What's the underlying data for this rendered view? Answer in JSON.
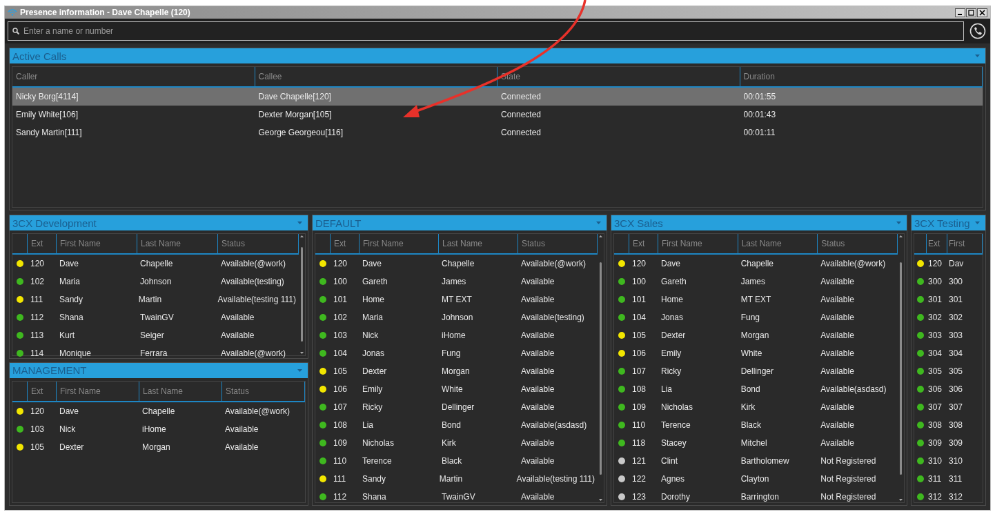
{
  "window": {
    "title": "Presence information - Dave Chapelle (120)"
  },
  "search": {
    "placeholder": "Enter a name or number"
  },
  "active_calls": {
    "title": "Active Calls",
    "columns": [
      "Caller",
      "Callee",
      "State",
      "Duration"
    ],
    "rows": [
      {
        "selected": true,
        "cells": [
          "Nicky Borg[4114]",
          "Dave Chapelle[120]",
          "Connected",
          "00:01:55"
        ]
      },
      {
        "selected": false,
        "cells": [
          "Emily White[106]",
          "Dexter Morgan[105]",
          "Connected",
          "00:01:43"
        ]
      },
      {
        "selected": false,
        "cells": [
          "Sandy Martin[111]",
          "George Georgeou[116]",
          "Connected",
          "00:01:11"
        ]
      }
    ]
  },
  "group_columns": [
    {
      "groups": [
        {
          "title": "3CX Development",
          "scrollbar": true,
          "columns": [
            "Ext",
            "First Name",
            "Last Name",
            "Status"
          ],
          "rows": [
            {
              "color": "#f2e600",
              "cells": [
                "120",
                "Dave",
                "Chapelle",
                "Available(@work)"
              ]
            },
            {
              "color": "#3fb81f",
              "cells": [
                "102",
                "Maria",
                "Johnson",
                "Available(testing)"
              ]
            },
            {
              "color": "#f2e600",
              "cells": [
                "111",
                "Sandy",
                "Martin",
                "Available(testing 111)"
              ]
            },
            {
              "color": "#3fb81f",
              "cells": [
                "112",
                "Shana",
                "TwainGV",
                "Available"
              ]
            },
            {
              "color": "#3fb81f",
              "cells": [
                "113",
                "Kurt",
                "Seiger",
                "Available"
              ]
            },
            {
              "color": "#3fb81f",
              "cells": [
                "114",
                "Monique",
                "Ferrara",
                "Available(@work)"
              ]
            }
          ]
        },
        {
          "title": "MANAGEMENT",
          "scrollbar": false,
          "columns": [
            "Ext",
            "First Name",
            "Last Name",
            "Status"
          ],
          "rows": [
            {
              "color": "#f2e600",
              "cells": [
                "120",
                "Dave",
                "Chapelle",
                "Available(@work)"
              ]
            },
            {
              "color": "#3fb81f",
              "cells": [
                "103",
                "Nick",
                "iHome",
                "Available"
              ]
            },
            {
              "color": "#f2e600",
              "cells": [
                "105",
                "Dexter",
                "Morgan",
                "Available"
              ]
            }
          ]
        }
      ]
    },
    {
      "groups": [
        {
          "title": "DEFAULT",
          "scrollbar": true,
          "columns": [
            "Ext",
            "First Name",
            "Last Name",
            "Status"
          ],
          "rows": [
            {
              "color": "#f2e600",
              "cells": [
                "120",
                "Dave",
                "Chapelle",
                "Available(@work)"
              ]
            },
            {
              "color": "#3fb81f",
              "cells": [
                "100",
                "Gareth",
                "James",
                "Available"
              ]
            },
            {
              "color": "#3fb81f",
              "cells": [
                "101",
                "Home",
                "MT EXT",
                "Available"
              ]
            },
            {
              "color": "#3fb81f",
              "cells": [
                "102",
                "Maria",
                "Johnson",
                "Available(testing)"
              ]
            },
            {
              "color": "#3fb81f",
              "cells": [
                "103",
                "Nick",
                "iHome",
                "Available"
              ]
            },
            {
              "color": "#3fb81f",
              "cells": [
                "104",
                "Jonas",
                "Fung",
                "Available"
              ]
            },
            {
              "color": "#f2e600",
              "cells": [
                "105",
                "Dexter",
                "Morgan",
                "Available"
              ]
            },
            {
              "color": "#f2e600",
              "cells": [
                "106",
                "Emily",
                "White",
                "Available"
              ]
            },
            {
              "color": "#3fb81f",
              "cells": [
                "107",
                "Ricky",
                "Dellinger",
                "Available"
              ]
            },
            {
              "color": "#3fb81f",
              "cells": [
                "108",
                "Lia",
                "Bond",
                "Available(asdasd)"
              ]
            },
            {
              "color": "#3fb81f",
              "cells": [
                "109",
                "Nicholas",
                "Kirk",
                "Available"
              ]
            },
            {
              "color": "#3fb81f",
              "cells": [
                "110",
                "Terence",
                "Black",
                "Available"
              ]
            },
            {
              "color": "#f2e600",
              "cells": [
                "111",
                "Sandy",
                "Martin",
                "Available(testing 111)"
              ]
            },
            {
              "color": "#3fb81f",
              "cells": [
                "112",
                "Shana",
                "TwainGV",
                "Available"
              ]
            }
          ]
        }
      ]
    },
    {
      "groups": [
        {
          "title": "3CX Sales",
          "scrollbar": true,
          "columns": [
            "Ext",
            "First Name",
            "Last Name",
            "Status"
          ],
          "rows": [
            {
              "color": "#f2e600",
              "cells": [
                "120",
                "Dave",
                "Chapelle",
                "Available(@work)"
              ]
            },
            {
              "color": "#3fb81f",
              "cells": [
                "100",
                "Gareth",
                "James",
                "Available"
              ]
            },
            {
              "color": "#3fb81f",
              "cells": [
                "101",
                "Home",
                "MT EXT",
                "Available"
              ]
            },
            {
              "color": "#3fb81f",
              "cells": [
                "104",
                "Jonas",
                "Fung",
                "Available"
              ]
            },
            {
              "color": "#f2e600",
              "cells": [
                "105",
                "Dexter",
                "Morgan",
                "Available"
              ]
            },
            {
              "color": "#f2e600",
              "cells": [
                "106",
                "Emily",
                "White",
                "Available"
              ]
            },
            {
              "color": "#3fb81f",
              "cells": [
                "107",
                "Ricky",
                "Dellinger",
                "Available"
              ]
            },
            {
              "color": "#3fb81f",
              "cells": [
                "108",
                "Lia",
                "Bond",
                "Available(asdasd)"
              ]
            },
            {
              "color": "#3fb81f",
              "cells": [
                "109",
                "Nicholas",
                "Kirk",
                "Available"
              ]
            },
            {
              "color": "#3fb81f",
              "cells": [
                "110",
                "Terence",
                "Black",
                "Available"
              ]
            },
            {
              "color": "#3fb81f",
              "cells": [
                "118",
                "Stacey",
                "Mitchel",
                "Available"
              ]
            },
            {
              "color": "#c8c8c8",
              "cells": [
                "121",
                "Clint",
                "Bartholomew",
                "Not Registered"
              ]
            },
            {
              "color": "#c8c8c8",
              "cells": [
                "122",
                "Agnes",
                "Clayton",
                "Not Registered"
              ]
            },
            {
              "color": "#c8c8c8",
              "cells": [
                "123",
                "Dorothy",
                "Barrington",
                "Not Registered"
              ]
            }
          ]
        }
      ]
    },
    {
      "groups": [
        {
          "title": "3CX Testing",
          "scrollbar": false,
          "columns": [
            "Ext",
            "First"
          ],
          "rows": [
            {
              "color": "#f2e600",
              "cells": [
                "120",
                "Dav"
              ]
            },
            {
              "color": "#3fb81f",
              "cells": [
                "300",
                "300"
              ]
            },
            {
              "color": "#3fb81f",
              "cells": [
                "301",
                "301"
              ]
            },
            {
              "color": "#3fb81f",
              "cells": [
                "302",
                "302"
              ]
            },
            {
              "color": "#3fb81f",
              "cells": [
                "303",
                "303"
              ]
            },
            {
              "color": "#3fb81f",
              "cells": [
                "304",
                "304"
              ]
            },
            {
              "color": "#3fb81f",
              "cells": [
                "305",
                "305"
              ]
            },
            {
              "color": "#3fb81f",
              "cells": [
                "306",
                "306"
              ]
            },
            {
              "color": "#3fb81f",
              "cells": [
                "307",
                "307"
              ]
            },
            {
              "color": "#3fb81f",
              "cells": [
                "308",
                "308"
              ]
            },
            {
              "color": "#3fb81f",
              "cells": [
                "309",
                "309"
              ]
            },
            {
              "color": "#3fb81f",
              "cells": [
                "310",
                "310"
              ]
            },
            {
              "color": "#3fb81f",
              "cells": [
                "311",
                "311"
              ]
            },
            {
              "color": "#3fb81f",
              "cells": [
                "312",
                "312"
              ]
            }
          ]
        }
      ]
    }
  ]
}
